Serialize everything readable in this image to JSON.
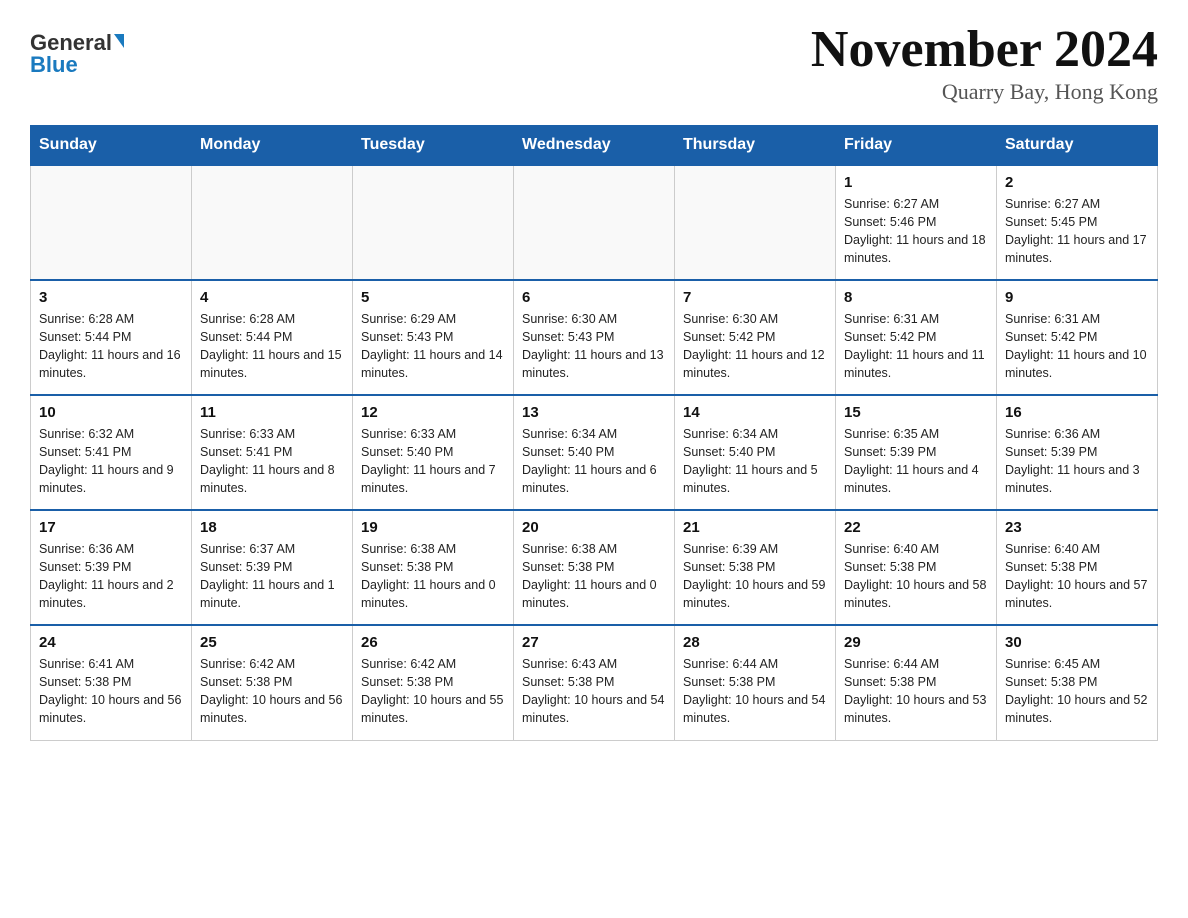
{
  "logo": {
    "general_text": "General",
    "blue_text": "Blue"
  },
  "title": "November 2024",
  "subtitle": "Quarry Bay, Hong Kong",
  "days_of_week": [
    "Sunday",
    "Monday",
    "Tuesday",
    "Wednesday",
    "Thursday",
    "Friday",
    "Saturday"
  ],
  "weeks": [
    [
      {
        "day": "",
        "info": ""
      },
      {
        "day": "",
        "info": ""
      },
      {
        "day": "",
        "info": ""
      },
      {
        "day": "",
        "info": ""
      },
      {
        "day": "",
        "info": ""
      },
      {
        "day": "1",
        "info": "Sunrise: 6:27 AM\nSunset: 5:46 PM\nDaylight: 11 hours and 18 minutes."
      },
      {
        "day": "2",
        "info": "Sunrise: 6:27 AM\nSunset: 5:45 PM\nDaylight: 11 hours and 17 minutes."
      }
    ],
    [
      {
        "day": "3",
        "info": "Sunrise: 6:28 AM\nSunset: 5:44 PM\nDaylight: 11 hours and 16 minutes."
      },
      {
        "day": "4",
        "info": "Sunrise: 6:28 AM\nSunset: 5:44 PM\nDaylight: 11 hours and 15 minutes."
      },
      {
        "day": "5",
        "info": "Sunrise: 6:29 AM\nSunset: 5:43 PM\nDaylight: 11 hours and 14 minutes."
      },
      {
        "day": "6",
        "info": "Sunrise: 6:30 AM\nSunset: 5:43 PM\nDaylight: 11 hours and 13 minutes."
      },
      {
        "day": "7",
        "info": "Sunrise: 6:30 AM\nSunset: 5:42 PM\nDaylight: 11 hours and 12 minutes."
      },
      {
        "day": "8",
        "info": "Sunrise: 6:31 AM\nSunset: 5:42 PM\nDaylight: 11 hours and 11 minutes."
      },
      {
        "day": "9",
        "info": "Sunrise: 6:31 AM\nSunset: 5:42 PM\nDaylight: 11 hours and 10 minutes."
      }
    ],
    [
      {
        "day": "10",
        "info": "Sunrise: 6:32 AM\nSunset: 5:41 PM\nDaylight: 11 hours and 9 minutes."
      },
      {
        "day": "11",
        "info": "Sunrise: 6:33 AM\nSunset: 5:41 PM\nDaylight: 11 hours and 8 minutes."
      },
      {
        "day": "12",
        "info": "Sunrise: 6:33 AM\nSunset: 5:40 PM\nDaylight: 11 hours and 7 minutes."
      },
      {
        "day": "13",
        "info": "Sunrise: 6:34 AM\nSunset: 5:40 PM\nDaylight: 11 hours and 6 minutes."
      },
      {
        "day": "14",
        "info": "Sunrise: 6:34 AM\nSunset: 5:40 PM\nDaylight: 11 hours and 5 minutes."
      },
      {
        "day": "15",
        "info": "Sunrise: 6:35 AM\nSunset: 5:39 PM\nDaylight: 11 hours and 4 minutes."
      },
      {
        "day": "16",
        "info": "Sunrise: 6:36 AM\nSunset: 5:39 PM\nDaylight: 11 hours and 3 minutes."
      }
    ],
    [
      {
        "day": "17",
        "info": "Sunrise: 6:36 AM\nSunset: 5:39 PM\nDaylight: 11 hours and 2 minutes."
      },
      {
        "day": "18",
        "info": "Sunrise: 6:37 AM\nSunset: 5:39 PM\nDaylight: 11 hours and 1 minute."
      },
      {
        "day": "19",
        "info": "Sunrise: 6:38 AM\nSunset: 5:38 PM\nDaylight: 11 hours and 0 minutes."
      },
      {
        "day": "20",
        "info": "Sunrise: 6:38 AM\nSunset: 5:38 PM\nDaylight: 11 hours and 0 minutes."
      },
      {
        "day": "21",
        "info": "Sunrise: 6:39 AM\nSunset: 5:38 PM\nDaylight: 10 hours and 59 minutes."
      },
      {
        "day": "22",
        "info": "Sunrise: 6:40 AM\nSunset: 5:38 PM\nDaylight: 10 hours and 58 minutes."
      },
      {
        "day": "23",
        "info": "Sunrise: 6:40 AM\nSunset: 5:38 PM\nDaylight: 10 hours and 57 minutes."
      }
    ],
    [
      {
        "day": "24",
        "info": "Sunrise: 6:41 AM\nSunset: 5:38 PM\nDaylight: 10 hours and 56 minutes."
      },
      {
        "day": "25",
        "info": "Sunrise: 6:42 AM\nSunset: 5:38 PM\nDaylight: 10 hours and 56 minutes."
      },
      {
        "day": "26",
        "info": "Sunrise: 6:42 AM\nSunset: 5:38 PM\nDaylight: 10 hours and 55 minutes."
      },
      {
        "day": "27",
        "info": "Sunrise: 6:43 AM\nSunset: 5:38 PM\nDaylight: 10 hours and 54 minutes."
      },
      {
        "day": "28",
        "info": "Sunrise: 6:44 AM\nSunset: 5:38 PM\nDaylight: 10 hours and 54 minutes."
      },
      {
        "day": "29",
        "info": "Sunrise: 6:44 AM\nSunset: 5:38 PM\nDaylight: 10 hours and 53 minutes."
      },
      {
        "day": "30",
        "info": "Sunrise: 6:45 AM\nSunset: 5:38 PM\nDaylight: 10 hours and 52 minutes."
      }
    ]
  ]
}
